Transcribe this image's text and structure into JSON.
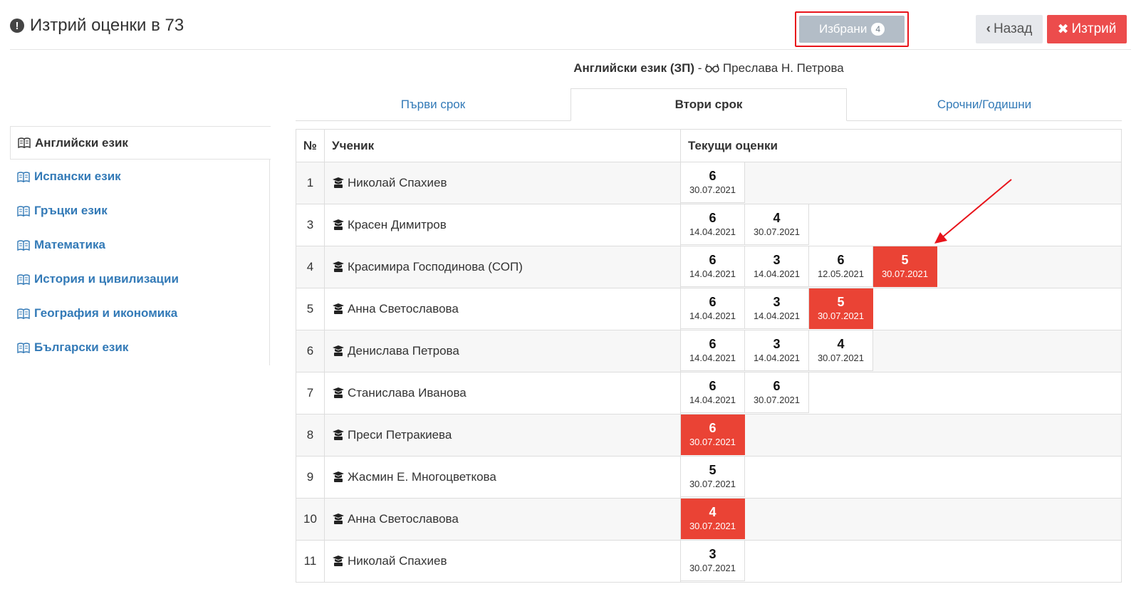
{
  "header": {
    "title": "Изтрий оценки в 73",
    "selected_label": "Избрани",
    "selected_count": "4",
    "back_label": "Назад",
    "delete_label": "Изтрий"
  },
  "subject_line": {
    "subject": "Английски език (ЗП)",
    "separator": "-",
    "teacher": "Преслава Н. Петрова"
  },
  "tabs": [
    {
      "label": "Първи срок",
      "active": false
    },
    {
      "label": "Втори срок",
      "active": true
    },
    {
      "label": "Срочни/Годишни",
      "active": false
    }
  ],
  "sidebar": {
    "items": [
      {
        "label": "Английски език",
        "active": true
      },
      {
        "label": "Испански език",
        "active": false
      },
      {
        "label": "Гръцки език",
        "active": false
      },
      {
        "label": "Математика",
        "active": false
      },
      {
        "label": "История и цивилизации",
        "active": false
      },
      {
        "label": "География и икономика",
        "active": false
      },
      {
        "label": "Български език",
        "active": false
      }
    ]
  },
  "table": {
    "headers": {
      "no": "№",
      "student": "Ученик",
      "grades": "Текущи оценки"
    },
    "rows": [
      {
        "no": "1",
        "student": "Николай Спахиев",
        "grades": [
          {
            "value": "6",
            "date": "30.07.2021",
            "selected": false
          }
        ]
      },
      {
        "no": "3",
        "student": "Красен Димитров",
        "grades": [
          {
            "value": "6",
            "date": "14.04.2021",
            "selected": false
          },
          {
            "value": "4",
            "date": "30.07.2021",
            "selected": false
          }
        ]
      },
      {
        "no": "4",
        "student": "Красимира Господинова (СОП)",
        "grades": [
          {
            "value": "6",
            "date": "14.04.2021",
            "selected": false
          },
          {
            "value": "3",
            "date": "14.04.2021",
            "selected": false
          },
          {
            "value": "6",
            "date": "12.05.2021",
            "selected": false
          },
          {
            "value": "5",
            "date": "30.07.2021",
            "selected": true
          }
        ]
      },
      {
        "no": "5",
        "student": "Анна Светославова",
        "grades": [
          {
            "value": "6",
            "date": "14.04.2021",
            "selected": false
          },
          {
            "value": "3",
            "date": "14.04.2021",
            "selected": false
          },
          {
            "value": "5",
            "date": "30.07.2021",
            "selected": true
          }
        ]
      },
      {
        "no": "6",
        "student": "Денислава Петрова",
        "grades": [
          {
            "value": "6",
            "date": "14.04.2021",
            "selected": false
          },
          {
            "value": "3",
            "date": "14.04.2021",
            "selected": false
          },
          {
            "value": "4",
            "date": "30.07.2021",
            "selected": false
          }
        ]
      },
      {
        "no": "7",
        "student": "Станислава Иванова",
        "grades": [
          {
            "value": "6",
            "date": "14.04.2021",
            "selected": false
          },
          {
            "value": "6",
            "date": "30.07.2021",
            "selected": false
          }
        ]
      },
      {
        "no": "8",
        "student": "Преси Петракиева",
        "grades": [
          {
            "value": "6",
            "date": "30.07.2021",
            "selected": true
          }
        ]
      },
      {
        "no": "9",
        "student": "Жасмин Е. Многоцветкова",
        "grades": [
          {
            "value": "5",
            "date": "30.07.2021",
            "selected": false
          }
        ]
      },
      {
        "no": "10",
        "student": "Анна Светославова",
        "grades": [
          {
            "value": "4",
            "date": "30.07.2021",
            "selected": true
          }
        ]
      },
      {
        "no": "11",
        "student": "Николай Спахиев",
        "grades": [
          {
            "value": "3",
            "date": "30.07.2021",
            "selected": false
          }
        ]
      }
    ]
  },
  "colors": {
    "selected_grade": "#ea4335",
    "link": "#337ab7",
    "delete_button": "#ec4c4c",
    "highlight_border": "#e8141b"
  }
}
